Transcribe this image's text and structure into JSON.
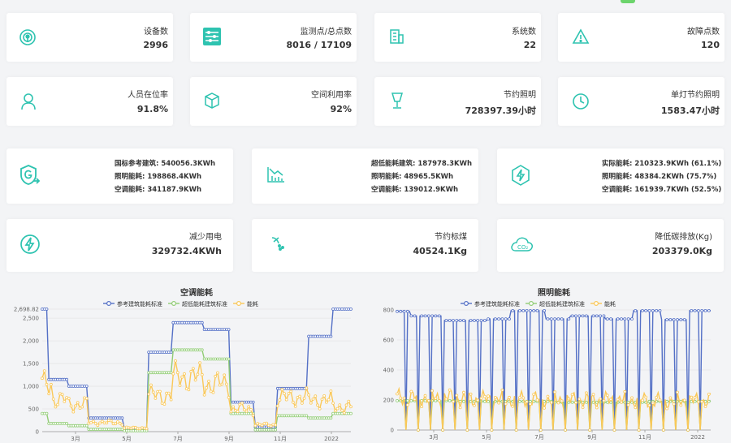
{
  "row1": [
    {
      "label": "设备数",
      "value": "2996",
      "icon": "broadcast-icon"
    },
    {
      "label": "监测点/总点数",
      "value": "8016 / 17109",
      "icon": "sliders-icon"
    },
    {
      "label": "系统数",
      "value": "22",
      "icon": "building-icon"
    },
    {
      "label": "故障点数",
      "value": "120",
      "icon": "warning-icon"
    }
  ],
  "row2": [
    {
      "label": "人员在位率",
      "value": "91.8%",
      "icon": "user-icon"
    },
    {
      "label": "空间利用率",
      "value": "92%",
      "icon": "cube-icon"
    },
    {
      "label": "节约照明",
      "value": "728397.39小时",
      "icon": "lamp-icon"
    },
    {
      "label": "单灯节约照明",
      "value": "1583.47小时",
      "icon": "clock-icon"
    }
  ],
  "row3": [
    {
      "icon": "shield-g-icon",
      "lines": [
        "国标参考建筑: 540056.3KWh",
        "照明能耗: 198868.4KWh",
        "空调能耗: 341187.9KWh"
      ]
    },
    {
      "icon": "bar-chart-down-icon",
      "lines": [
        "超低能耗建筑: 187978.3KWh",
        "照明能耗: 48965.5KWh",
        "空调能耗: 139012.9KWh"
      ]
    },
    {
      "icon": "hexagon-bolt-icon",
      "lines": [
        "实际能耗: 210323.9KWh (61.1%)",
        "照明能耗: 48384.2KWh (75.7%)",
        "空调能耗: 161939.7KWh (52.5%)"
      ]
    }
  ],
  "row4": [
    {
      "label": "减少用电",
      "value": "329732.4KWh",
      "icon": "bolt-circle-icon"
    },
    {
      "label": "节约标煤",
      "value": "40524.1Kg",
      "icon": "coal-icon"
    },
    {
      "label": "降低碳排放(Kg)",
      "value": "203379.0Kg",
      "icon": "co2-cloud-icon"
    }
  ],
  "colors": {
    "accent": "#2ec3b0",
    "series_reference": "#5470c6",
    "series_ultra_low": "#91cc75",
    "series_actual": "#fac858"
  },
  "chart_data": [
    {
      "type": "line",
      "title": "空调能耗",
      "legend_position": "top-center",
      "series": [
        {
          "name": "参考建筑能耗标准",
          "levels": [
            [
              0,
              2698.82
            ],
            [
              0.02,
              1150
            ],
            [
              0.08,
              1000
            ],
            [
              0.15,
              300
            ],
            [
              0.26,
              60
            ],
            [
              0.34,
              1750
            ],
            [
              0.42,
              2400
            ],
            [
              0.52,
              2250
            ],
            [
              0.61,
              650
            ],
            [
              0.69,
              100
            ],
            [
              0.76,
              950
            ],
            [
              0.86,
              2100
            ],
            [
              0.94,
              2698.82
            ]
          ]
        },
        {
          "name": "超低能耗建筑标准",
          "levels": [
            [
              0,
              400
            ],
            [
              0.02,
              180
            ],
            [
              0.08,
              130
            ],
            [
              0.15,
              50
            ],
            [
              0.26,
              20
            ],
            [
              0.34,
              1300
            ],
            [
              0.42,
              1800
            ],
            [
              0.52,
              1600
            ],
            [
              0.61,
              400
            ],
            [
              0.69,
              40
            ],
            [
              0.76,
              350
            ],
            [
              0.86,
              300
            ],
            [
              0.94,
              400
            ]
          ]
        },
        {
          "name": "能耗",
          "levels": [
            [
              0,
              1050
            ],
            [
              0.03,
              700
            ],
            [
              0.08,
              600
            ],
            [
              0.15,
              200
            ],
            [
              0.26,
              80
            ],
            [
              0.34,
              800
            ],
            [
              0.42,
              1200
            ],
            [
              0.52,
              1050
            ],
            [
              0.61,
              500
            ],
            [
              0.69,
              150
            ],
            [
              0.76,
              750
            ],
            [
              0.86,
              700
            ],
            [
              0.94,
              550
            ]
          ]
        }
      ],
      "x_ticks": [
        "3月",
        "5月",
        "7月",
        "9月",
        "11月",
        "2022"
      ],
      "y_ticks": [
        "0",
        "500",
        "1,000",
        "1,500",
        "2,000",
        "2,500",
        "2,698.82"
      ],
      "ylim": [
        0,
        2698.82
      ],
      "grid": true
    },
    {
      "type": "line",
      "title": "照明能耗",
      "legend_position": "top-center",
      "series": [
        {
          "name": "参考建筑能耗标准",
          "levels": [
            [
              0,
              790
            ],
            [
              0.04,
              760
            ],
            [
              0.15,
              730
            ],
            [
              0.29,
              740
            ],
            [
              0.36,
              795
            ],
            [
              0.47,
              740
            ],
            [
              0.55,
              760
            ],
            [
              0.66,
              740
            ],
            [
              0.75,
              795
            ],
            [
              0.84,
              735
            ],
            [
              0.93,
              795
            ]
          ]
        },
        {
          "name": "超低能耗建筑标准",
          "levels": [
            [
              0,
              195
            ],
            [
              0.2,
              190
            ],
            [
              0.5,
              185
            ],
            [
              0.8,
              190
            ],
            [
              1,
              195
            ]
          ]
        },
        {
          "name": "能耗",
          "levels": [
            [
              0,
              215
            ],
            [
              0.2,
              205
            ],
            [
              0.5,
              200
            ],
            [
              0.8,
              195
            ],
            [
              1,
              205
            ]
          ]
        }
      ],
      "x_ticks": [
        "3月",
        "5月",
        "7月",
        "9月",
        "11月",
        "2022"
      ],
      "y_ticks": [
        "0",
        "200",
        "400",
        "600",
        "800"
      ],
      "ylim": [
        0,
        800
      ],
      "grid": true
    }
  ]
}
